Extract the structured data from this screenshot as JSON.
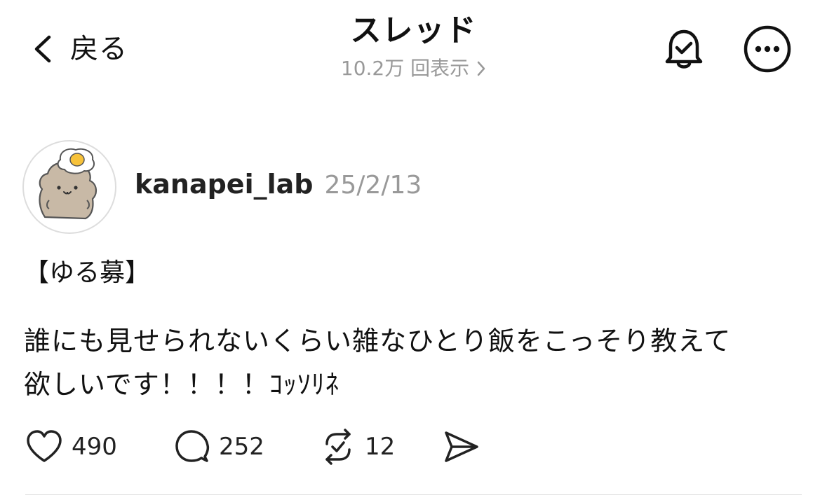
{
  "header": {
    "back_label": "戻る",
    "title": "スレッド",
    "views": "10.2万 回表示"
  },
  "post": {
    "author": "kanapei_lab",
    "date": "25/2/13",
    "tag": "【ゆる募】",
    "body_line1": "誰にも見せられないくらい雑なひとり飯をこっそり教えて",
    "body_line2": "欲しいです！！！！ｺｯｿﾘﾈ",
    "likes": "490",
    "replies": "252",
    "reposts": "12"
  },
  "icons": {
    "back": "chevron-left-icon",
    "views_arrow": "chevron-right-icon",
    "notify": "bell-check-icon",
    "more": "more-horizontal-icon",
    "like": "heart-icon",
    "reply": "comment-icon",
    "repost": "repost-icon",
    "share": "send-icon"
  }
}
